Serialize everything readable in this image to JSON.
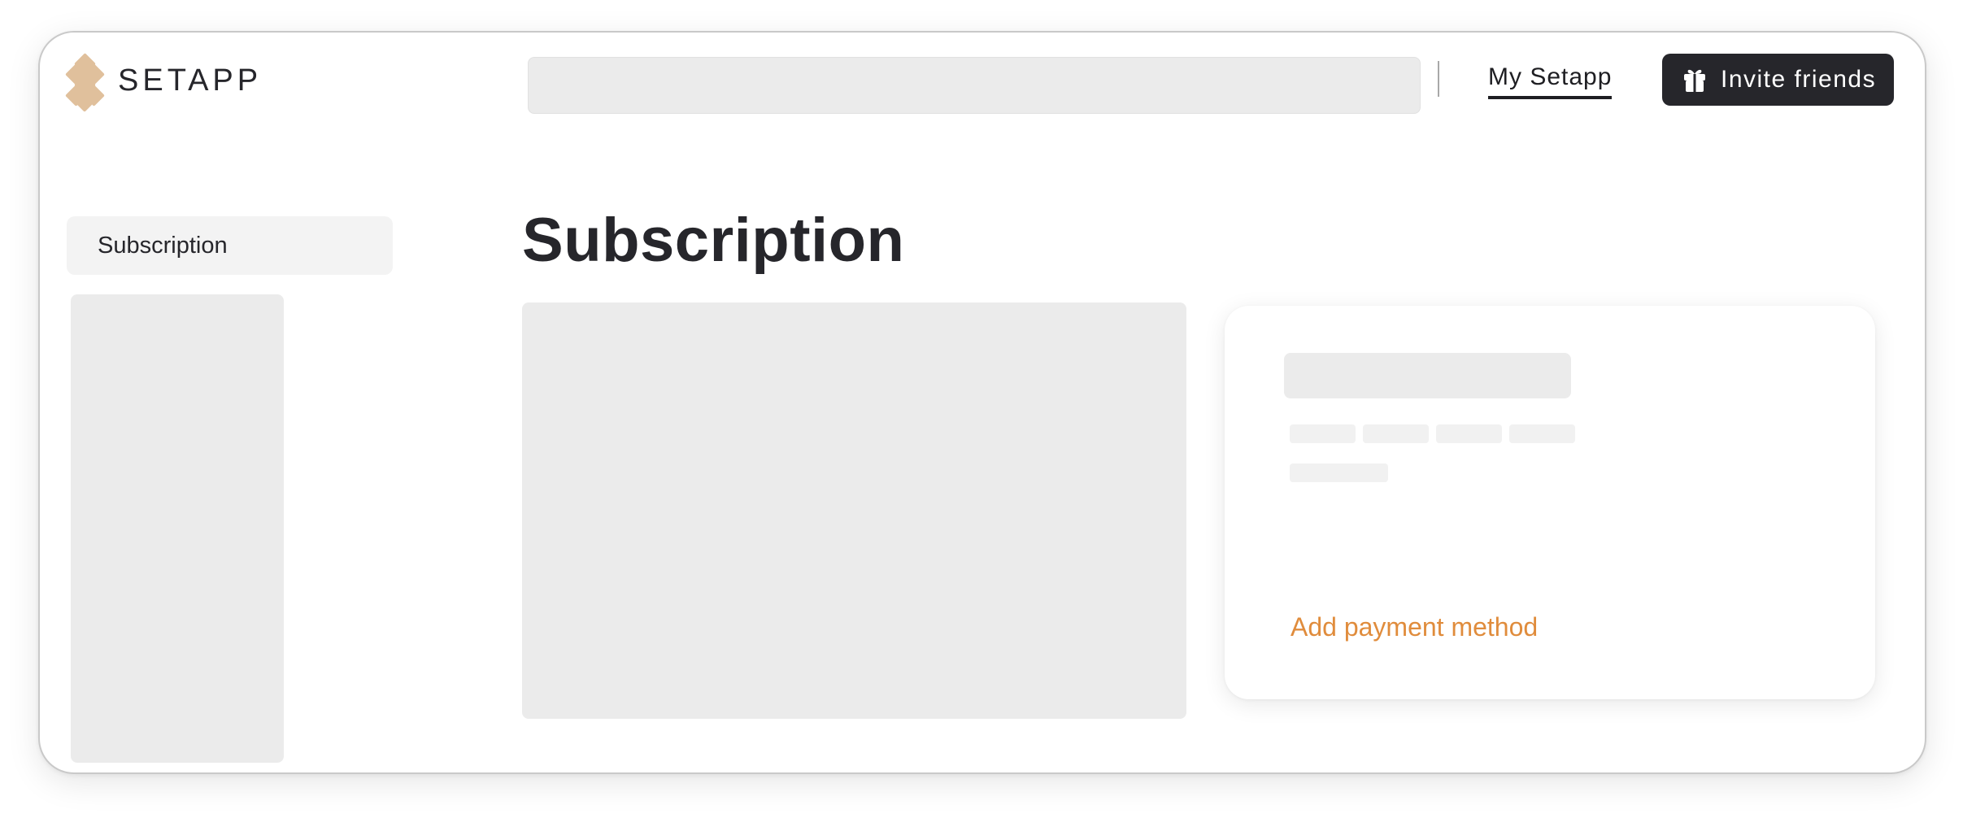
{
  "brand": {
    "name": "SETAPP",
    "logo_icon": "setapp-diamond-logo-icon",
    "logo_color": "#e0c09c"
  },
  "header": {
    "search": {
      "placeholder": ""
    },
    "nav_link": "My Setapp",
    "invite_button": {
      "label": "Invite friends",
      "icon": "gift-icon"
    }
  },
  "sidebar": {
    "items": [
      {
        "label": "Subscription"
      }
    ]
  },
  "main": {
    "title": "Subscription",
    "payment_card": {
      "add_payment_label": "Add payment method"
    }
  },
  "colors": {
    "accent": "#e08c3c",
    "text_dark": "#26262b",
    "skeleton": "#ebebeb"
  }
}
